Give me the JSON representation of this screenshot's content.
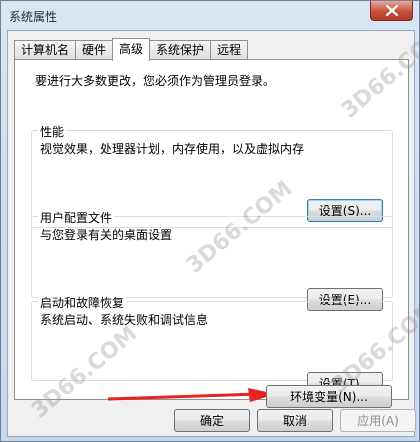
{
  "window": {
    "title": "系统属性"
  },
  "tabs": [
    {
      "label": "计算机名",
      "active": false
    },
    {
      "label": "硬件",
      "active": false
    },
    {
      "label": "高级",
      "active": true
    },
    {
      "label": "系统保护",
      "active": false
    },
    {
      "label": "远程",
      "active": false
    }
  ],
  "notice": "要进行大多数更改，您必须作为管理员登录。",
  "performance": {
    "title": "性能",
    "desc": "视觉效果，处理器计划，内存使用，以及虚拟内存",
    "button": "设置(S)..."
  },
  "profile": {
    "title": "用户配置文件",
    "desc": "与您登录有关的桌面设置",
    "button": "设置(E)..."
  },
  "startup": {
    "title": "启动和故障恢复",
    "desc": "系统启动、系统失败和调试信息",
    "button": "设置(T)..."
  },
  "env_button": "环境变量(N)...",
  "footer": {
    "ok": "确定",
    "cancel": "取消",
    "apply": "应用(A)"
  },
  "watermark": {
    "text": "3D66.COM",
    "sub": "3D66.COM"
  },
  "colors": {
    "arrow": "#e8231f",
    "close": "#c7503d"
  },
  "icons": {
    "close": "close-icon",
    "arrow": "red-arrow-annotation"
  }
}
